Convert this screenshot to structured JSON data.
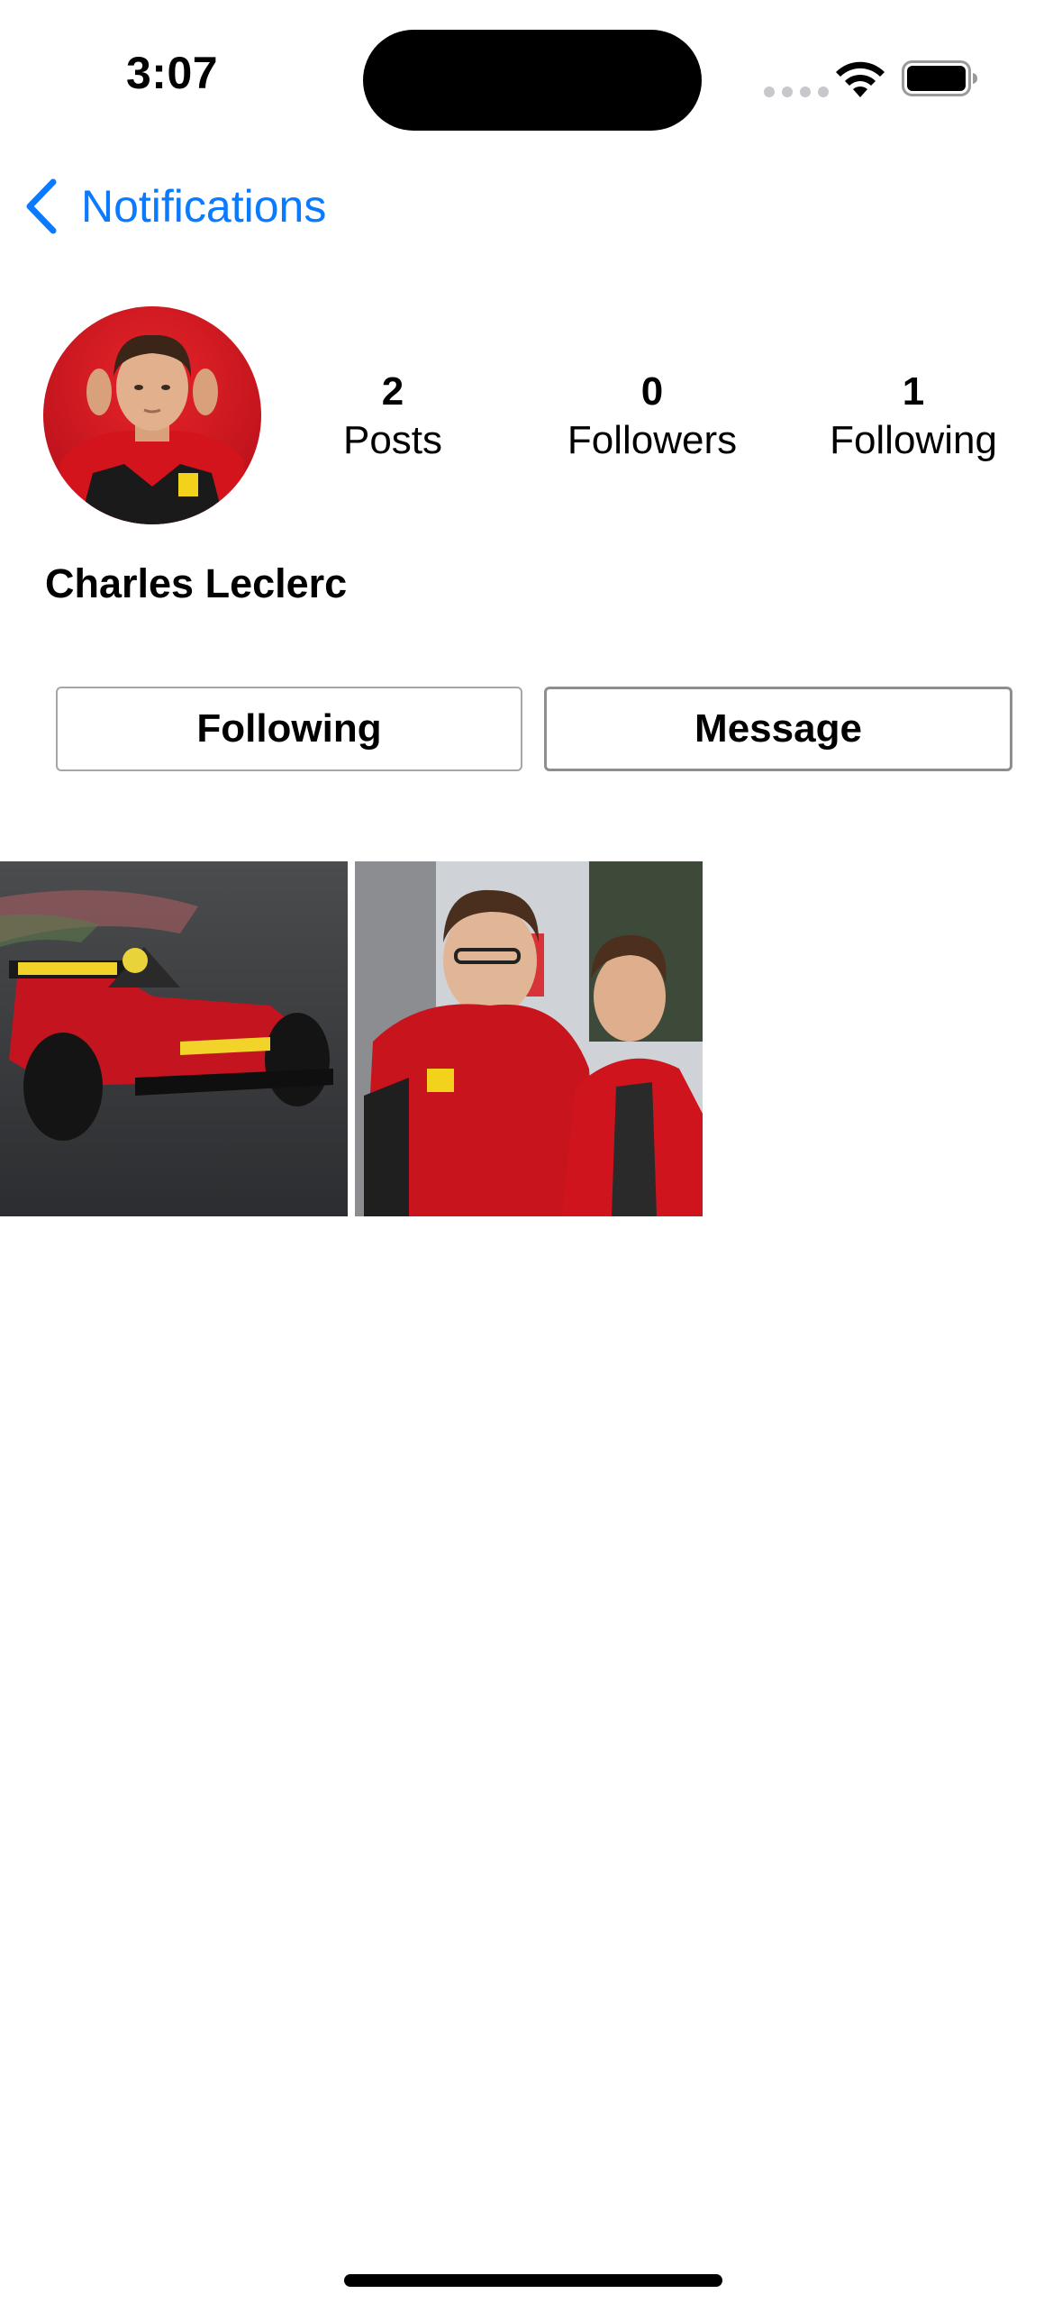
{
  "status_bar": {
    "time": "3:07"
  },
  "nav": {
    "back_label": "Notifications"
  },
  "profile": {
    "name": "Charles Leclerc",
    "stats": [
      {
        "value": "2",
        "label": "Posts"
      },
      {
        "value": "0",
        "label": "Followers"
      },
      {
        "value": "1",
        "label": "Following"
      }
    ]
  },
  "actions": {
    "following_label": "Following",
    "message_label": "Message"
  },
  "colors": {
    "accent": "#0a7aff",
    "button_border": "#a6a6a6"
  },
  "icons": {
    "back": "chevron-left-icon",
    "wifi": "wifi-icon",
    "battery": "battery-icon"
  }
}
